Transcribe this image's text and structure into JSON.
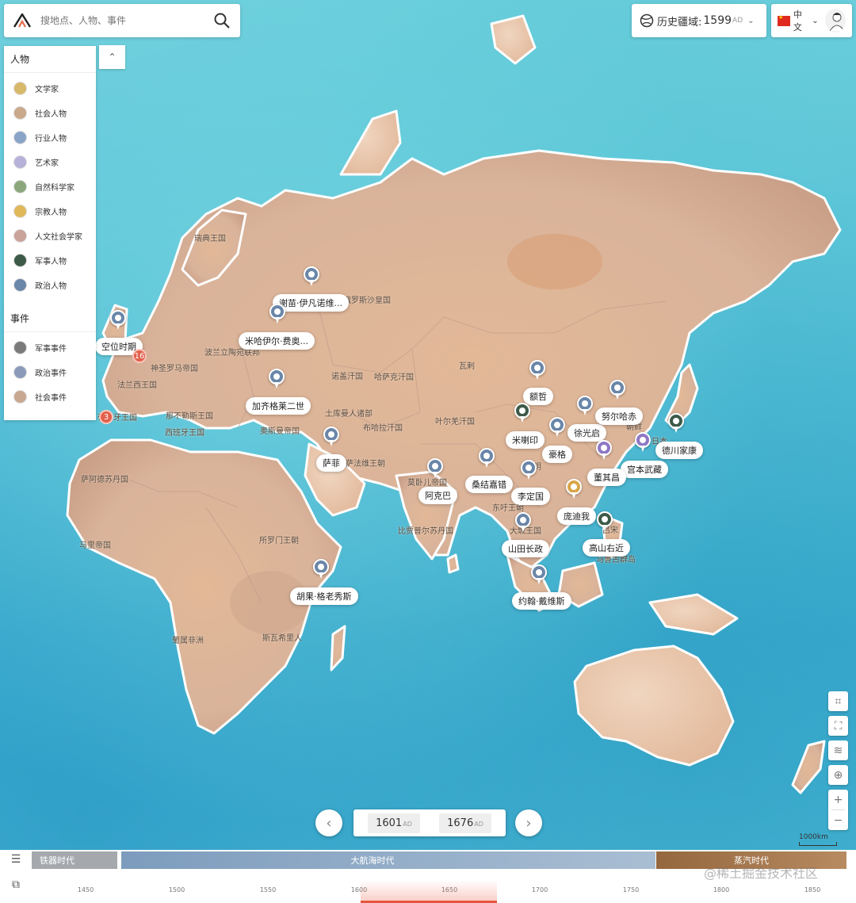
{
  "search": {
    "placeholder": "搜地点、人物、事件",
    "logo": "a-logo-icon",
    "button_icon": "search-icon"
  },
  "era_selector": {
    "label": "历史疆域:",
    "year": "1599",
    "unit": "AD",
    "icon": "history-globe-icon"
  },
  "language": {
    "label": "中文",
    "flag": "china-flag-icon"
  },
  "panel": {
    "people_title": "人物",
    "people": [
      {
        "label": "文学家",
        "color": "#d8b86a"
      },
      {
        "label": "社会人物",
        "color": "#c9a98a"
      },
      {
        "label": "行业人物",
        "color": "#8aa4c8"
      },
      {
        "label": "艺术家",
        "color": "#b6b1d8"
      },
      {
        "label": "自然科学家",
        "color": "#8aa87c"
      },
      {
        "label": "宗教人物",
        "color": "#e0b85a"
      },
      {
        "label": "人文社会学家",
        "color": "#c9a29a"
      },
      {
        "label": "军事人物",
        "color": "#3d5a48"
      },
      {
        "label": "政治人物",
        "color": "#6a86a8"
      }
    ],
    "events_title": "事件",
    "events": [
      {
        "label": "军事事件",
        "color": "#7a7a7a"
      },
      {
        "label": "政治事件",
        "color": "#8a9ab8"
      },
      {
        "label": "社会事件",
        "color": "#c8a890"
      }
    ]
  },
  "place_names": [
    "瑞典王国",
    "俄罗斯沙皇国",
    "波兰立陶宛联邦",
    "神圣罗马帝国",
    "法兰西王国",
    "葡萄牙王国",
    "西班牙王国",
    "那不勒斯王国",
    "奥斯曼帝国",
    "诺盖汗国",
    "哈萨克汗国",
    "土库曼人诸部",
    "布哈拉汗国",
    "叶尔羌汗国",
    "瓦剌",
    "莫卧儿帝国",
    "比贾普尔苏丹国",
    "东吁王朝",
    "大城王国",
    "萨法维王朝",
    "萨阿德苏丹国",
    "马里帝国",
    "所罗门王朝",
    "斯瓦希里人",
    "葡属非洲",
    "朝鲜",
    "明",
    "吕宋",
    "马鲁古群岛",
    "日本"
  ],
  "markers": [
    {
      "label": "谢苗·伊凡诺维...",
      "style": "blue"
    },
    {
      "label": "米哈伊尔·费奥...",
      "style": "blue"
    },
    {
      "label": "空位时期",
      "style": "blue"
    },
    {
      "label": "加齐格莱二世",
      "style": "blue"
    },
    {
      "label": "萨菲",
      "style": "blue"
    },
    {
      "label": "阿克巴",
      "style": "blue"
    },
    {
      "label": "桑结嘉错",
      "style": "blue"
    },
    {
      "label": "李定国",
      "style": "blue"
    },
    {
      "label": "额哲",
      "style": "blue"
    },
    {
      "label": "米喇印",
      "style": "green"
    },
    {
      "label": "豪格",
      "style": "blue"
    },
    {
      "label": "徐光启",
      "style": "blue"
    },
    {
      "label": "努尔哈赤",
      "style": "blue"
    },
    {
      "label": "宫本武藏",
      "style": "purple"
    },
    {
      "label": "德川家康",
      "style": "green"
    },
    {
      "label": "董其昌",
      "style": "purple"
    },
    {
      "label": "庞迪我",
      "style": "gold"
    },
    {
      "label": "高山右近",
      "style": "green"
    },
    {
      "label": "山田长政",
      "style": "blue"
    },
    {
      "label": "约翰·戴维斯",
      "style": "blue"
    },
    {
      "label": "胡果·格老秀斯",
      "style": "blue"
    }
  ],
  "clusters": [
    {
      "count": "16"
    },
    {
      "count": "3"
    }
  ],
  "tools": [
    "ruler-icon",
    "select-area-icon",
    "layers-icon",
    "locate-icon",
    "zoom-in-icon",
    "zoom-out-icon"
  ],
  "scale": "1000km",
  "range": {
    "start": "1601",
    "end": "1676",
    "unit": "AD"
  },
  "timeline": {
    "eras": [
      {
        "label": "铁器时代",
        "color": "#a5a9ae"
      },
      {
        "label": "大航海时代",
        "color": "#7f9fbf"
      },
      {
        "label": "蒸汽时代",
        "color": "#9a6d45"
      }
    ],
    "ticks": [
      "1450",
      "1500",
      "1550",
      "1600",
      "1650",
      "1700",
      "1750",
      "1800",
      "1850"
    ]
  },
  "watermark": "@稀土掘金技术社区"
}
